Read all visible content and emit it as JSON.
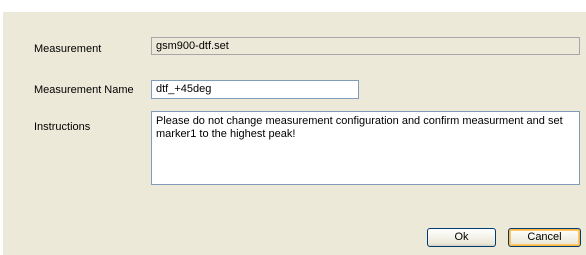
{
  "measurement": {
    "label": "Measurement",
    "value": "gsm900-dtf.set"
  },
  "measurement_name": {
    "label": "Measurement Name",
    "value": "dtf_+45deg"
  },
  "instructions": {
    "label": "Instructions",
    "value": "Please do not change measurement configuration and confirm measurment and set marker1 to the highest peak!"
  },
  "buttons": {
    "ok_label": "Ok",
    "cancel_label": "Cancel"
  },
  "colors": {
    "dialog_background": "#ece9d8",
    "input_border": "#7f9db9",
    "button_border": "#003c74",
    "default_button_highlight": "#ffb53c"
  }
}
